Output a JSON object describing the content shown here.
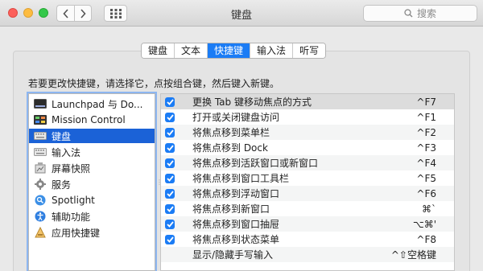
{
  "window": {
    "title": "键盘"
  },
  "search": {
    "placeholder": "搜索"
  },
  "tabs": [
    {
      "label": "键盘",
      "active": false
    },
    {
      "label": "文本",
      "active": false
    },
    {
      "label": "快捷键",
      "active": true
    },
    {
      "label": "输入法",
      "active": false
    },
    {
      "label": "听写",
      "active": false
    }
  ],
  "instruction": "若要更改快捷键，请选择它，点按组合键，然后键入新键。",
  "categories": [
    {
      "label": "Launchpad 与 Do...",
      "icon": "launchpad-icon",
      "selected": false
    },
    {
      "label": "Mission Control",
      "icon": "mission-control-icon",
      "selected": false
    },
    {
      "label": "键盘",
      "icon": "keyboard-icon",
      "selected": true
    },
    {
      "label": "输入法",
      "icon": "input-method-icon",
      "selected": false
    },
    {
      "label": "屏幕快照",
      "icon": "screenshot-icon",
      "selected": false
    },
    {
      "label": "服务",
      "icon": "gear-icon",
      "selected": false
    },
    {
      "label": "Spotlight",
      "icon": "spotlight-icon",
      "selected": false
    },
    {
      "label": "辅助功能",
      "icon": "accessibility-icon",
      "selected": false
    },
    {
      "label": "应用快捷键",
      "icon": "app-shortcuts-icon",
      "selected": false
    }
  ],
  "shortcuts": [
    {
      "label": "更换 Tab 键移动焦点的方式",
      "key": "^F7",
      "checked": false
    },
    {
      "label": "打开或关闭键盘访问",
      "key": "^F1",
      "checked": true
    },
    {
      "label": "将焦点移到菜单栏",
      "key": "^F2",
      "checked": true
    },
    {
      "label": "将焦点移到 Dock",
      "key": "^F3",
      "checked": true
    },
    {
      "label": "将焦点移到活跃窗口或新窗口",
      "key": "^F4",
      "checked": true
    },
    {
      "label": "将焦点移到窗口工具栏",
      "key": "^F5",
      "checked": true
    },
    {
      "label": "将焦点移到浮动窗口",
      "key": "^F6",
      "checked": true
    },
    {
      "label": "将焦点移到新窗口",
      "key": "⌘`",
      "checked": true
    },
    {
      "label": "将焦点移到窗口抽屉",
      "key": "⌥⌘'",
      "checked": true
    },
    {
      "label": "将焦点移到状态菜单",
      "key": "^F8",
      "checked": true
    },
    {
      "label": "显示/隐藏手写输入",
      "key": "^⇧空格键",
      "checked": false
    }
  ],
  "colors": {
    "accent": "#1b7cf5",
    "selection": "#1b62d7"
  }
}
